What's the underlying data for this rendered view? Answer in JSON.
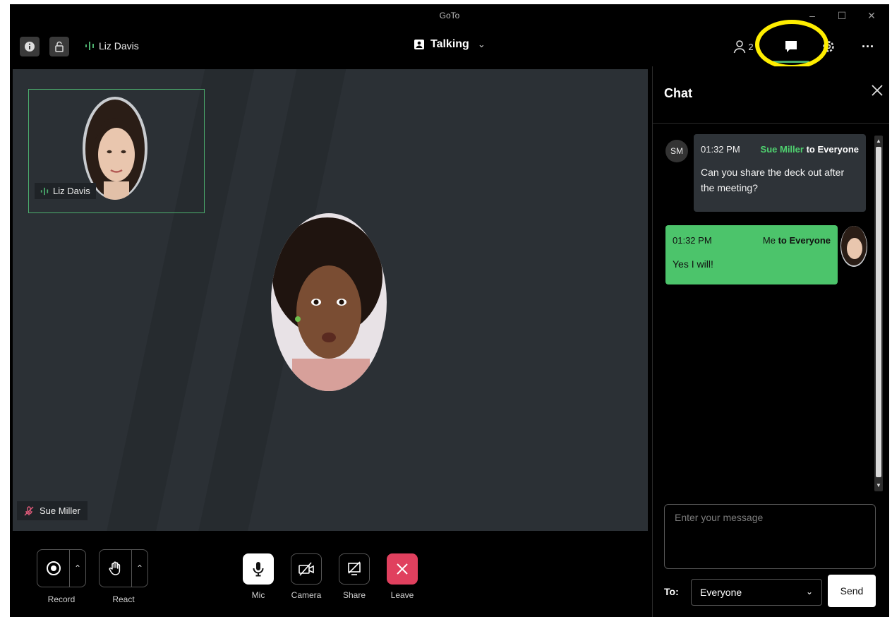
{
  "window": {
    "title": "GoTo"
  },
  "topbar": {
    "speaker_name": "Liz Davis",
    "view_mode": "Talking",
    "participant_count": "2",
    "colors": {
      "accent": "#4caf6e",
      "highlight": "#ffee00"
    }
  },
  "stage": {
    "thumbnail_label": "Liz Davis",
    "bottom_name_tag": "Sue Miller"
  },
  "controls": {
    "record_label": "Record",
    "react_label": "React",
    "mic_label": "Mic",
    "camera_label": "Camera",
    "share_label": "Share",
    "leave_label": "Leave"
  },
  "chat": {
    "title": "Chat",
    "messages": [
      {
        "initials": "SM",
        "time": "01:32 PM",
        "sender": "Sue Miller",
        "to_text": "to Everyone",
        "text": "Can you share the deck out after the meeting?"
      },
      {
        "time": "01:32 PM",
        "sender": "Me",
        "to_text": "to Everyone",
        "text": "Yes I will!"
      }
    ],
    "input_placeholder": "Enter your message",
    "to_label": "To:",
    "recipient": "Everyone",
    "send_label": "Send"
  }
}
